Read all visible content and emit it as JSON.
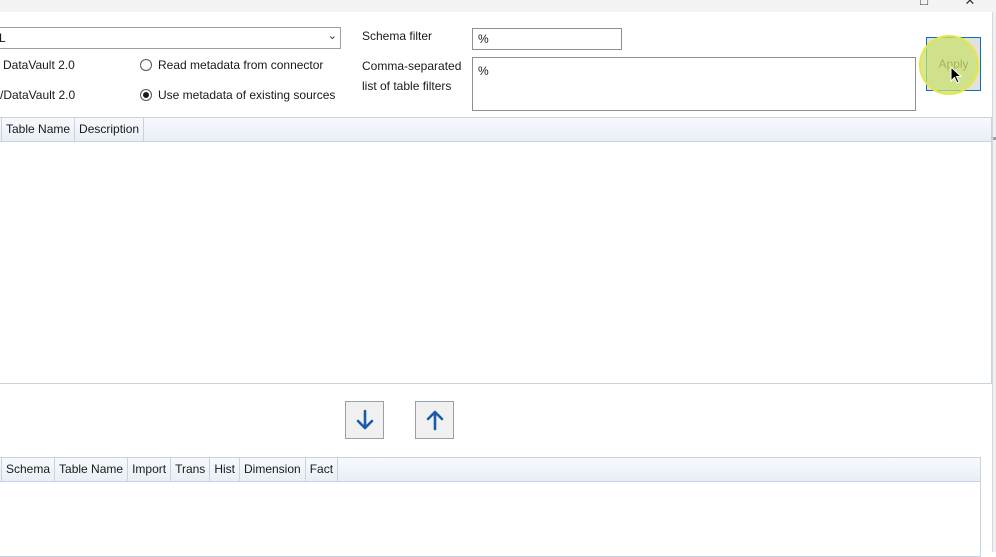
{
  "window": {
    "restore_glyph": "□",
    "close_glyph": "✕"
  },
  "connection": {
    "selected_value": "L"
  },
  "data_vault": {
    "source_label": "DataVault 2.0",
    "target_label": "/DataVault 2.0"
  },
  "metadata_source": {
    "options": [
      {
        "label": "Read metadata from connector",
        "checked": false
      },
      {
        "label": "Use metadata of existing sources",
        "checked": true
      }
    ]
  },
  "schema_filter": {
    "label": "Schema filter",
    "value": "%"
  },
  "table_filter": {
    "label_line1": "Comma-separated",
    "label_line2": "list of table filters",
    "value": "%"
  },
  "apply_button": {
    "label": "Apply"
  },
  "source_grid": {
    "columns": [
      "Table Name",
      "Description"
    ]
  },
  "target_grid": {
    "columns": [
      "Schema",
      "Table Name",
      "Import",
      "Trans",
      "Hist",
      "Dimension",
      "Fact"
    ]
  },
  "move_buttons": {
    "down_icon": "arrow-down-icon",
    "up_icon": "arrow-up-icon",
    "color": "#1a5aa8"
  }
}
